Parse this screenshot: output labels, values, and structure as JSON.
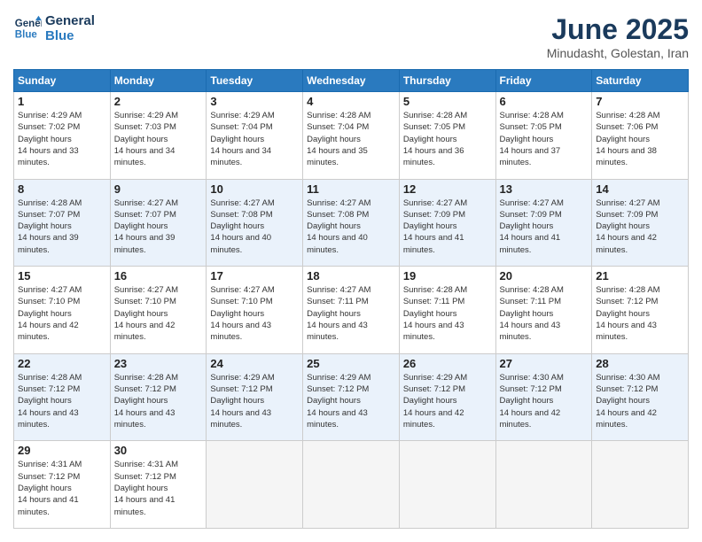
{
  "logo": {
    "line1": "General",
    "line2": "Blue"
  },
  "title": "June 2025",
  "subtitle": "Minudasht, Golestan, Iran",
  "weekdays": [
    "Sunday",
    "Monday",
    "Tuesday",
    "Wednesday",
    "Thursday",
    "Friday",
    "Saturday"
  ],
  "weeks": [
    [
      {
        "day": "1",
        "sunrise": "4:29 AM",
        "sunset": "7:02 PM",
        "daylight": "14 hours and 33 minutes."
      },
      {
        "day": "2",
        "sunrise": "4:29 AM",
        "sunset": "7:03 PM",
        "daylight": "14 hours and 34 minutes."
      },
      {
        "day": "3",
        "sunrise": "4:29 AM",
        "sunset": "7:04 PM",
        "daylight": "14 hours and 34 minutes."
      },
      {
        "day": "4",
        "sunrise": "4:28 AM",
        "sunset": "7:04 PM",
        "daylight": "14 hours and 35 minutes."
      },
      {
        "day": "5",
        "sunrise": "4:28 AM",
        "sunset": "7:05 PM",
        "daylight": "14 hours and 36 minutes."
      },
      {
        "day": "6",
        "sunrise": "4:28 AM",
        "sunset": "7:05 PM",
        "daylight": "14 hours and 37 minutes."
      },
      {
        "day": "7",
        "sunrise": "4:28 AM",
        "sunset": "7:06 PM",
        "daylight": "14 hours and 38 minutes."
      }
    ],
    [
      {
        "day": "8",
        "sunrise": "4:28 AM",
        "sunset": "7:07 PM",
        "daylight": "14 hours and 39 minutes."
      },
      {
        "day": "9",
        "sunrise": "4:27 AM",
        "sunset": "7:07 PM",
        "daylight": "14 hours and 39 minutes."
      },
      {
        "day": "10",
        "sunrise": "4:27 AM",
        "sunset": "7:08 PM",
        "daylight": "14 hours and 40 minutes."
      },
      {
        "day": "11",
        "sunrise": "4:27 AM",
        "sunset": "7:08 PM",
        "daylight": "14 hours and 40 minutes."
      },
      {
        "day": "12",
        "sunrise": "4:27 AM",
        "sunset": "7:09 PM",
        "daylight": "14 hours and 41 minutes."
      },
      {
        "day": "13",
        "sunrise": "4:27 AM",
        "sunset": "7:09 PM",
        "daylight": "14 hours and 41 minutes."
      },
      {
        "day": "14",
        "sunrise": "4:27 AM",
        "sunset": "7:09 PM",
        "daylight": "14 hours and 42 minutes."
      }
    ],
    [
      {
        "day": "15",
        "sunrise": "4:27 AM",
        "sunset": "7:10 PM",
        "daylight": "14 hours and 42 minutes."
      },
      {
        "day": "16",
        "sunrise": "4:27 AM",
        "sunset": "7:10 PM",
        "daylight": "14 hours and 42 minutes."
      },
      {
        "day": "17",
        "sunrise": "4:27 AM",
        "sunset": "7:10 PM",
        "daylight": "14 hours and 43 minutes."
      },
      {
        "day": "18",
        "sunrise": "4:27 AM",
        "sunset": "7:11 PM",
        "daylight": "14 hours and 43 minutes."
      },
      {
        "day": "19",
        "sunrise": "4:28 AM",
        "sunset": "7:11 PM",
        "daylight": "14 hours and 43 minutes."
      },
      {
        "day": "20",
        "sunrise": "4:28 AM",
        "sunset": "7:11 PM",
        "daylight": "14 hours and 43 minutes."
      },
      {
        "day": "21",
        "sunrise": "4:28 AM",
        "sunset": "7:12 PM",
        "daylight": "14 hours and 43 minutes."
      }
    ],
    [
      {
        "day": "22",
        "sunrise": "4:28 AM",
        "sunset": "7:12 PM",
        "daylight": "14 hours and 43 minutes."
      },
      {
        "day": "23",
        "sunrise": "4:28 AM",
        "sunset": "7:12 PM",
        "daylight": "14 hours and 43 minutes."
      },
      {
        "day": "24",
        "sunrise": "4:29 AM",
        "sunset": "7:12 PM",
        "daylight": "14 hours and 43 minutes."
      },
      {
        "day": "25",
        "sunrise": "4:29 AM",
        "sunset": "7:12 PM",
        "daylight": "14 hours and 43 minutes."
      },
      {
        "day": "26",
        "sunrise": "4:29 AM",
        "sunset": "7:12 PM",
        "daylight": "14 hours and 42 minutes."
      },
      {
        "day": "27",
        "sunrise": "4:30 AM",
        "sunset": "7:12 PM",
        "daylight": "14 hours and 42 minutes."
      },
      {
        "day": "28",
        "sunrise": "4:30 AM",
        "sunset": "7:12 PM",
        "daylight": "14 hours and 42 minutes."
      }
    ],
    [
      {
        "day": "29",
        "sunrise": "4:31 AM",
        "sunset": "7:12 PM",
        "daylight": "14 hours and 41 minutes."
      },
      {
        "day": "30",
        "sunrise": "4:31 AM",
        "sunset": "7:12 PM",
        "daylight": "14 hours and 41 minutes."
      },
      null,
      null,
      null,
      null,
      null
    ]
  ]
}
